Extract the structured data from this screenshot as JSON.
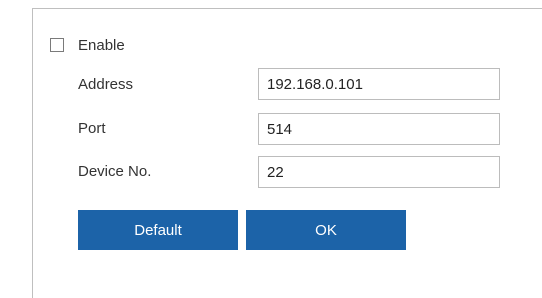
{
  "form": {
    "enable": {
      "label": "Enable",
      "checked": false
    },
    "fields": [
      {
        "label": "Address",
        "value": "192.168.0.101"
      },
      {
        "label": "Port",
        "value": "514"
      },
      {
        "label": "Device No.",
        "value": "22"
      }
    ],
    "buttons": {
      "default_label": "Default",
      "ok_label": "OK"
    }
  },
  "colors": {
    "button_background": "#1c63a8",
    "button_text": "#ffffff",
    "border": "#bfbfbf"
  }
}
